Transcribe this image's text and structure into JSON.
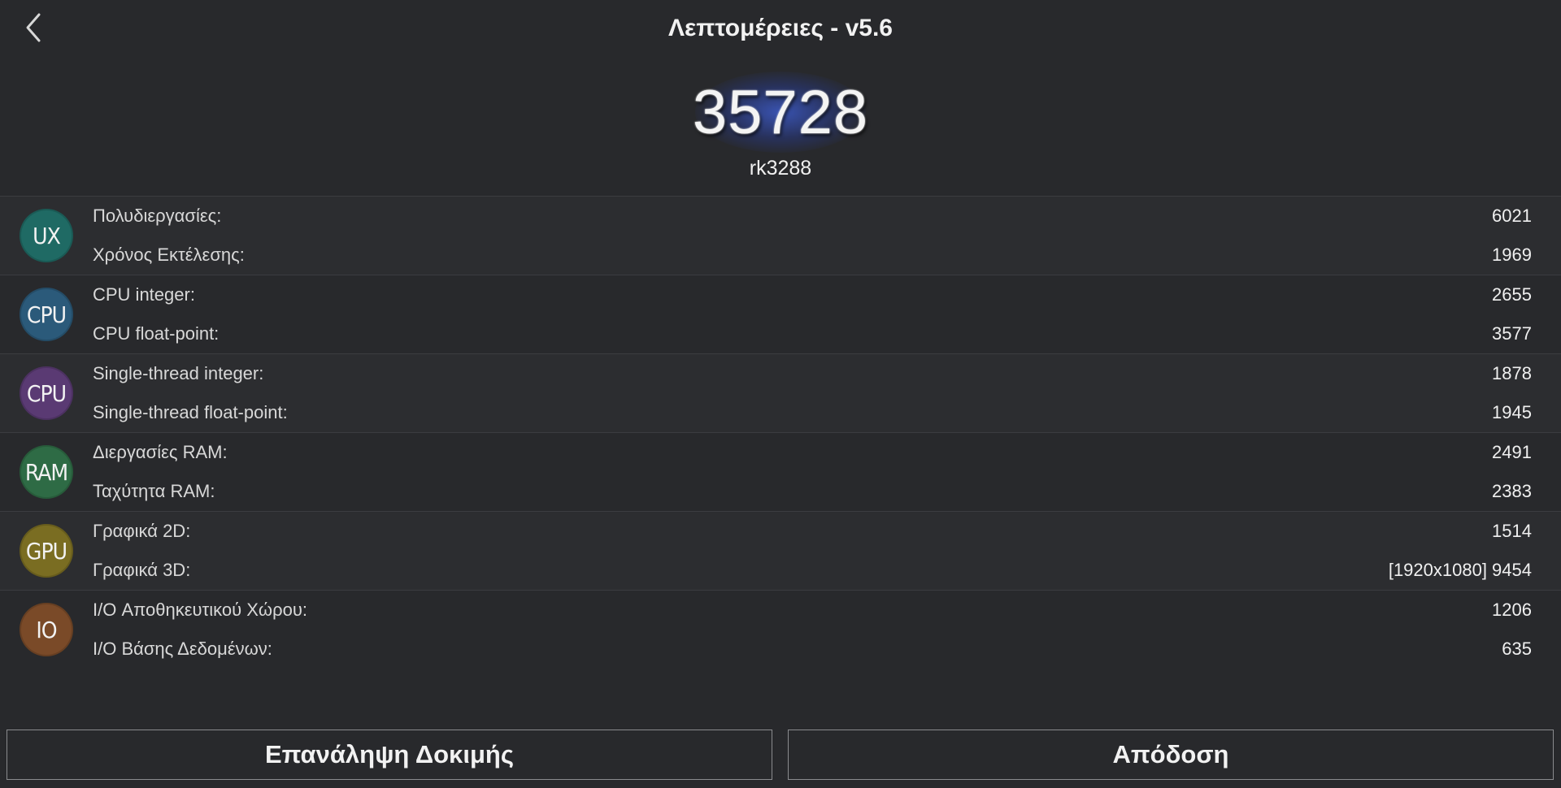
{
  "header": {
    "title": "Λεπτομέρειες - v5.6"
  },
  "score": {
    "total": "35728",
    "device": "rk3288"
  },
  "groups": [
    {
      "badge": "UX",
      "badge_color": "#1f6a64",
      "rows": [
        {
          "label": "Πολυδιεργασίες:",
          "value": "6021"
        },
        {
          "label": "Χρόνος Εκτέλεσης:",
          "value": "1969"
        }
      ]
    },
    {
      "badge": "CPU",
      "badge_color": "#2b5a7a",
      "rows": [
        {
          "label": "CPU integer:",
          "value": "2655"
        },
        {
          "label": "CPU float-point:",
          "value": "3577"
        }
      ]
    },
    {
      "badge": "CPU",
      "badge_color": "#5a3a73",
      "rows": [
        {
          "label": "Single-thread integer:",
          "value": "1878"
        },
        {
          "label": "Single-thread float-point:",
          "value": "1945"
        }
      ]
    },
    {
      "badge": "RAM",
      "badge_color": "#2e6b45",
      "rows": [
        {
          "label": "Διεργασίες RAM:",
          "value": "2491"
        },
        {
          "label": "Ταχύτητα RAM:",
          "value": "2383"
        }
      ]
    },
    {
      "badge": "GPU",
      "badge_color": "#7a6d22",
      "rows": [
        {
          "label": "Γραφικά 2D:",
          "value": "1514"
        },
        {
          "label": "Γραφικά 3D:",
          "value": "[1920x1080] 9454"
        }
      ]
    },
    {
      "badge": "IO",
      "badge_color": "#7a4a28",
      "rows": [
        {
          "label": "I/O Αποθηκευτικού Χώρου:",
          "value": "1206"
        },
        {
          "label": "I/O Βάσης Δεδομένων:",
          "value": "635"
        }
      ]
    }
  ],
  "buttons": {
    "repeat": "Επανάληψη Δοκιμής",
    "performance": "Απόδοση"
  },
  "icons": {
    "back": "chevron-left-icon"
  }
}
